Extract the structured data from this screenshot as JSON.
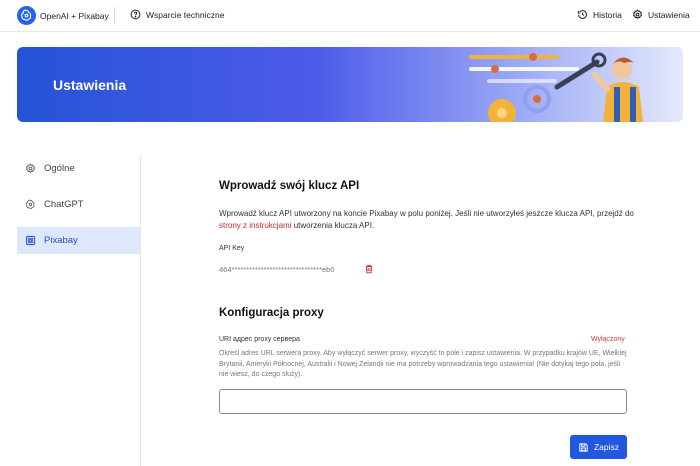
{
  "header": {
    "brand": "OpenAI + Pixabay",
    "support_label": "Wsparcie techniczne",
    "history_label": "Historia",
    "settings_label": "Ustawienia"
  },
  "banner": {
    "title": "Ustawienia"
  },
  "sidebar": {
    "items": [
      {
        "label": "Ogólne",
        "icon": "gear-icon",
        "active": false
      },
      {
        "label": "ChatGPT",
        "icon": "openai-icon",
        "active": false
      },
      {
        "label": "Pixabay",
        "icon": "pixabay-icon",
        "active": true
      }
    ]
  },
  "api": {
    "heading": "Wprowadź swój klucz API",
    "desc_part1": "Wprowadź klucz API utworzony na koncie Pixabay w polu poniżej. Jeśli nie utworzyłeś jeszcze klucza API, przejdź do ",
    "desc_link": "strony z instrukcjami",
    "desc_part2": " utworzenia klucza API.",
    "key_label": "API Key",
    "key_value": "464*******************************eb0"
  },
  "proxy": {
    "heading": "Konfiguracja proxy",
    "label": "URI адрес proxy сервера",
    "status": "Wyłączony",
    "help": "Określ adres URL serwera proxy. Aby wyłączyć serwer proxy, wyczyść to pole i zapisz ustawienia. W przypadku krajów UE, Wielkiej Brytanii, Ameryki Północnej, Australii i Nowej Zelandii nie ma potrzeby wprowadzania tego ustawienia! (Nie dotykaj tego pola, jeśli nie wiesz, do czego służy).",
    "value": "",
    "save_label": "Zapisz"
  },
  "colors": {
    "accent": "#2257e0",
    "active_bg": "#dfe7fb",
    "status_off": "#d23b3b",
    "link": "#c62a2a"
  }
}
